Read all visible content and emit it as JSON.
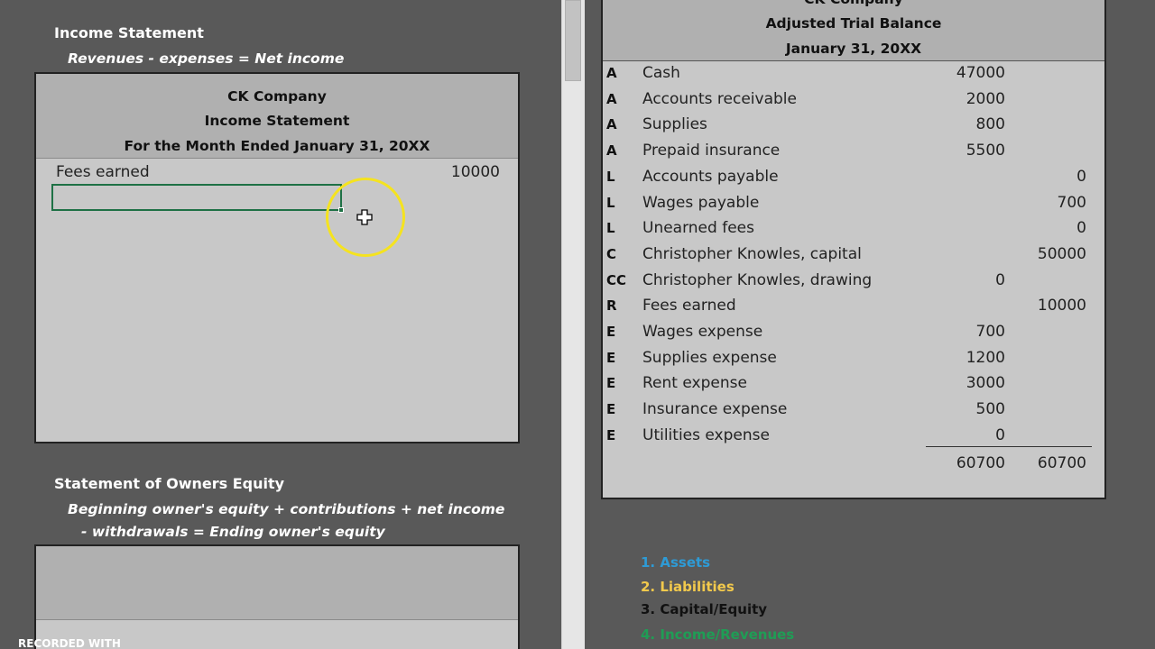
{
  "left_pane": {
    "income_section_title": "Income Statement",
    "income_formula": "Revenues - expenses = Net income",
    "income_statement": {
      "company": "CK Company",
      "title": "Income Statement",
      "period": "For the Month Ended January 31, 20XX",
      "rows": [
        {
          "label": "Fees earned",
          "amount": "10000"
        }
      ]
    },
    "equity_section_title": "Statement of Owners Equity",
    "equity_formula_line1": "Beginning owner's equity + contributions + net income",
    "equity_formula_line2": "- withdrawals = Ending owner's equity"
  },
  "trial_balance": {
    "company": "CK Company",
    "title": "Adjusted Trial Balance",
    "date": "January 31, 20XX",
    "rows": [
      {
        "type": "A",
        "account": "Cash",
        "debit": "47000",
        "credit": ""
      },
      {
        "type": "A",
        "account": "Accounts receivable",
        "debit": "2000",
        "credit": ""
      },
      {
        "type": "A",
        "account": "Supplies",
        "debit": "800",
        "credit": ""
      },
      {
        "type": "A",
        "account": "Prepaid insurance",
        "debit": "5500",
        "credit": ""
      },
      {
        "type": "L",
        "account": "Accounts payable",
        "debit": "",
        "credit": "0"
      },
      {
        "type": "L",
        "account": "Wages payable",
        "debit": "",
        "credit": "700"
      },
      {
        "type": "L",
        "account": "Unearned fees",
        "debit": "",
        "credit": "0"
      },
      {
        "type": "C",
        "account": "Christopher Knowles, capital",
        "debit": "",
        "credit": "50000"
      },
      {
        "type": "CC",
        "account": "Christopher Knowles, drawing",
        "debit": "0",
        "credit": ""
      },
      {
        "type": "R",
        "account": "Fees earned",
        "debit": "",
        "credit": "10000"
      },
      {
        "type": "E",
        "account": "Wages expense",
        "debit": "700",
        "credit": ""
      },
      {
        "type": "E",
        "account": "Supplies expense",
        "debit": "1200",
        "credit": ""
      },
      {
        "type": "E",
        "account": "Rent expense",
        "debit": "3000",
        "credit": ""
      },
      {
        "type": "E",
        "account": "Insurance expense",
        "debit": "500",
        "credit": ""
      },
      {
        "type": "E",
        "account": "Utilities expense",
        "debit": "0",
        "credit": ""
      }
    ],
    "total_debit": "60700",
    "total_credit": "60700"
  },
  "legend": {
    "items": [
      {
        "label": "1. Assets",
        "color": "#2e9bd6"
      },
      {
        "label": "2. Liabilities",
        "color": "#f2c94c"
      },
      {
        "label": "3. Capital/Equity",
        "color": "#111111"
      },
      {
        "label": "4. Income/Revenues",
        "color": "#1f9d55"
      }
    ]
  },
  "watermark": "RECORDED WITH",
  "icons": {
    "cursor": "cell-select-plus-cursor-icon"
  }
}
